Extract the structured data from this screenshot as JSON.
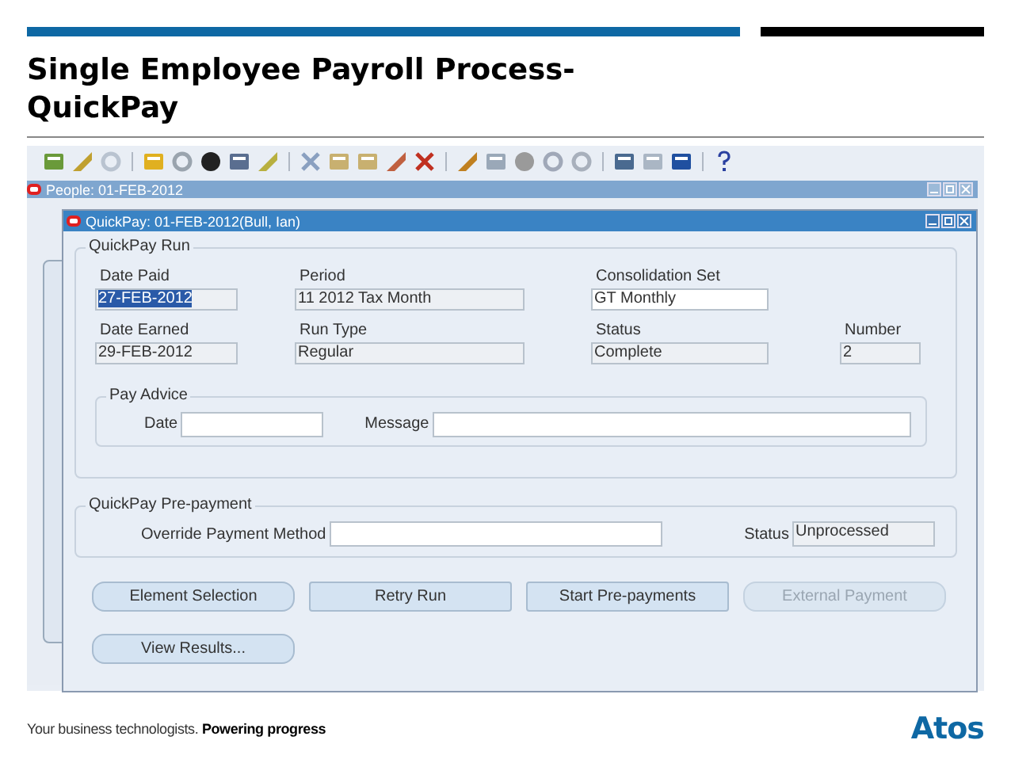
{
  "slide": {
    "title": "Single Employee Payroll Process-QuickPay",
    "footer_tagline": "Your business technologists. **Powering progress**",
    "logo": "Atos"
  },
  "app": {
    "back_window": {
      "title": "People: 01-FEB-2012"
    },
    "window": {
      "title": "QuickPay: 01-FEB-2012(Bull, Ian)",
      "run_group": {
        "title": "QuickPay Run",
        "fields": [
          {
            "label": "Date Paid",
            "value": "27-FEB-2012",
            "read_only": true,
            "selected": true
          },
          {
            "label": "Period",
            "value": "11 2012 Tax Month",
            "read_only": true,
            "selected": false
          },
          {
            "label": "Consolidation Set",
            "value": "GT Monthly",
            "read_only": false,
            "selected": false
          },
          {
            "label": "Date Earned",
            "value": "29-FEB-2012",
            "read_only": true,
            "selected": false
          },
          {
            "label": "Run Type",
            "value": "Regular",
            "read_only": true,
            "selected": false
          },
          {
            "label": "Status",
            "value": "Complete",
            "read_only": true,
            "selected": false
          },
          {
            "label": "Number",
            "value": "2",
            "read_only": true,
            "selected": false
          }
        ],
        "pay_advice": {
          "title": "Pay  Advice",
          "date_label": "Date",
          "message_label": "Message"
        }
      },
      "prepayment_group": {
        "title": "QuickPay Pre-payment",
        "method_label": "Override Payment Method",
        "status_label": "Status",
        "status_value": "Unprocessed"
      },
      "buttons": [
        {
          "label": "Element Selection",
          "kind": "rounded",
          "disabled": false
        },
        {
          "label": "Retry Run",
          "kind": "square",
          "disabled": false
        },
        {
          "label": "Start Pre-payments",
          "kind": "square",
          "disabled": false
        },
        {
          "label": "External Payment",
          "kind": "rounded",
          "disabled": true
        },
        {
          "label": "View Results...",
          "kind": "rounded",
          "disabled": false
        }
      ]
    }
  }
}
